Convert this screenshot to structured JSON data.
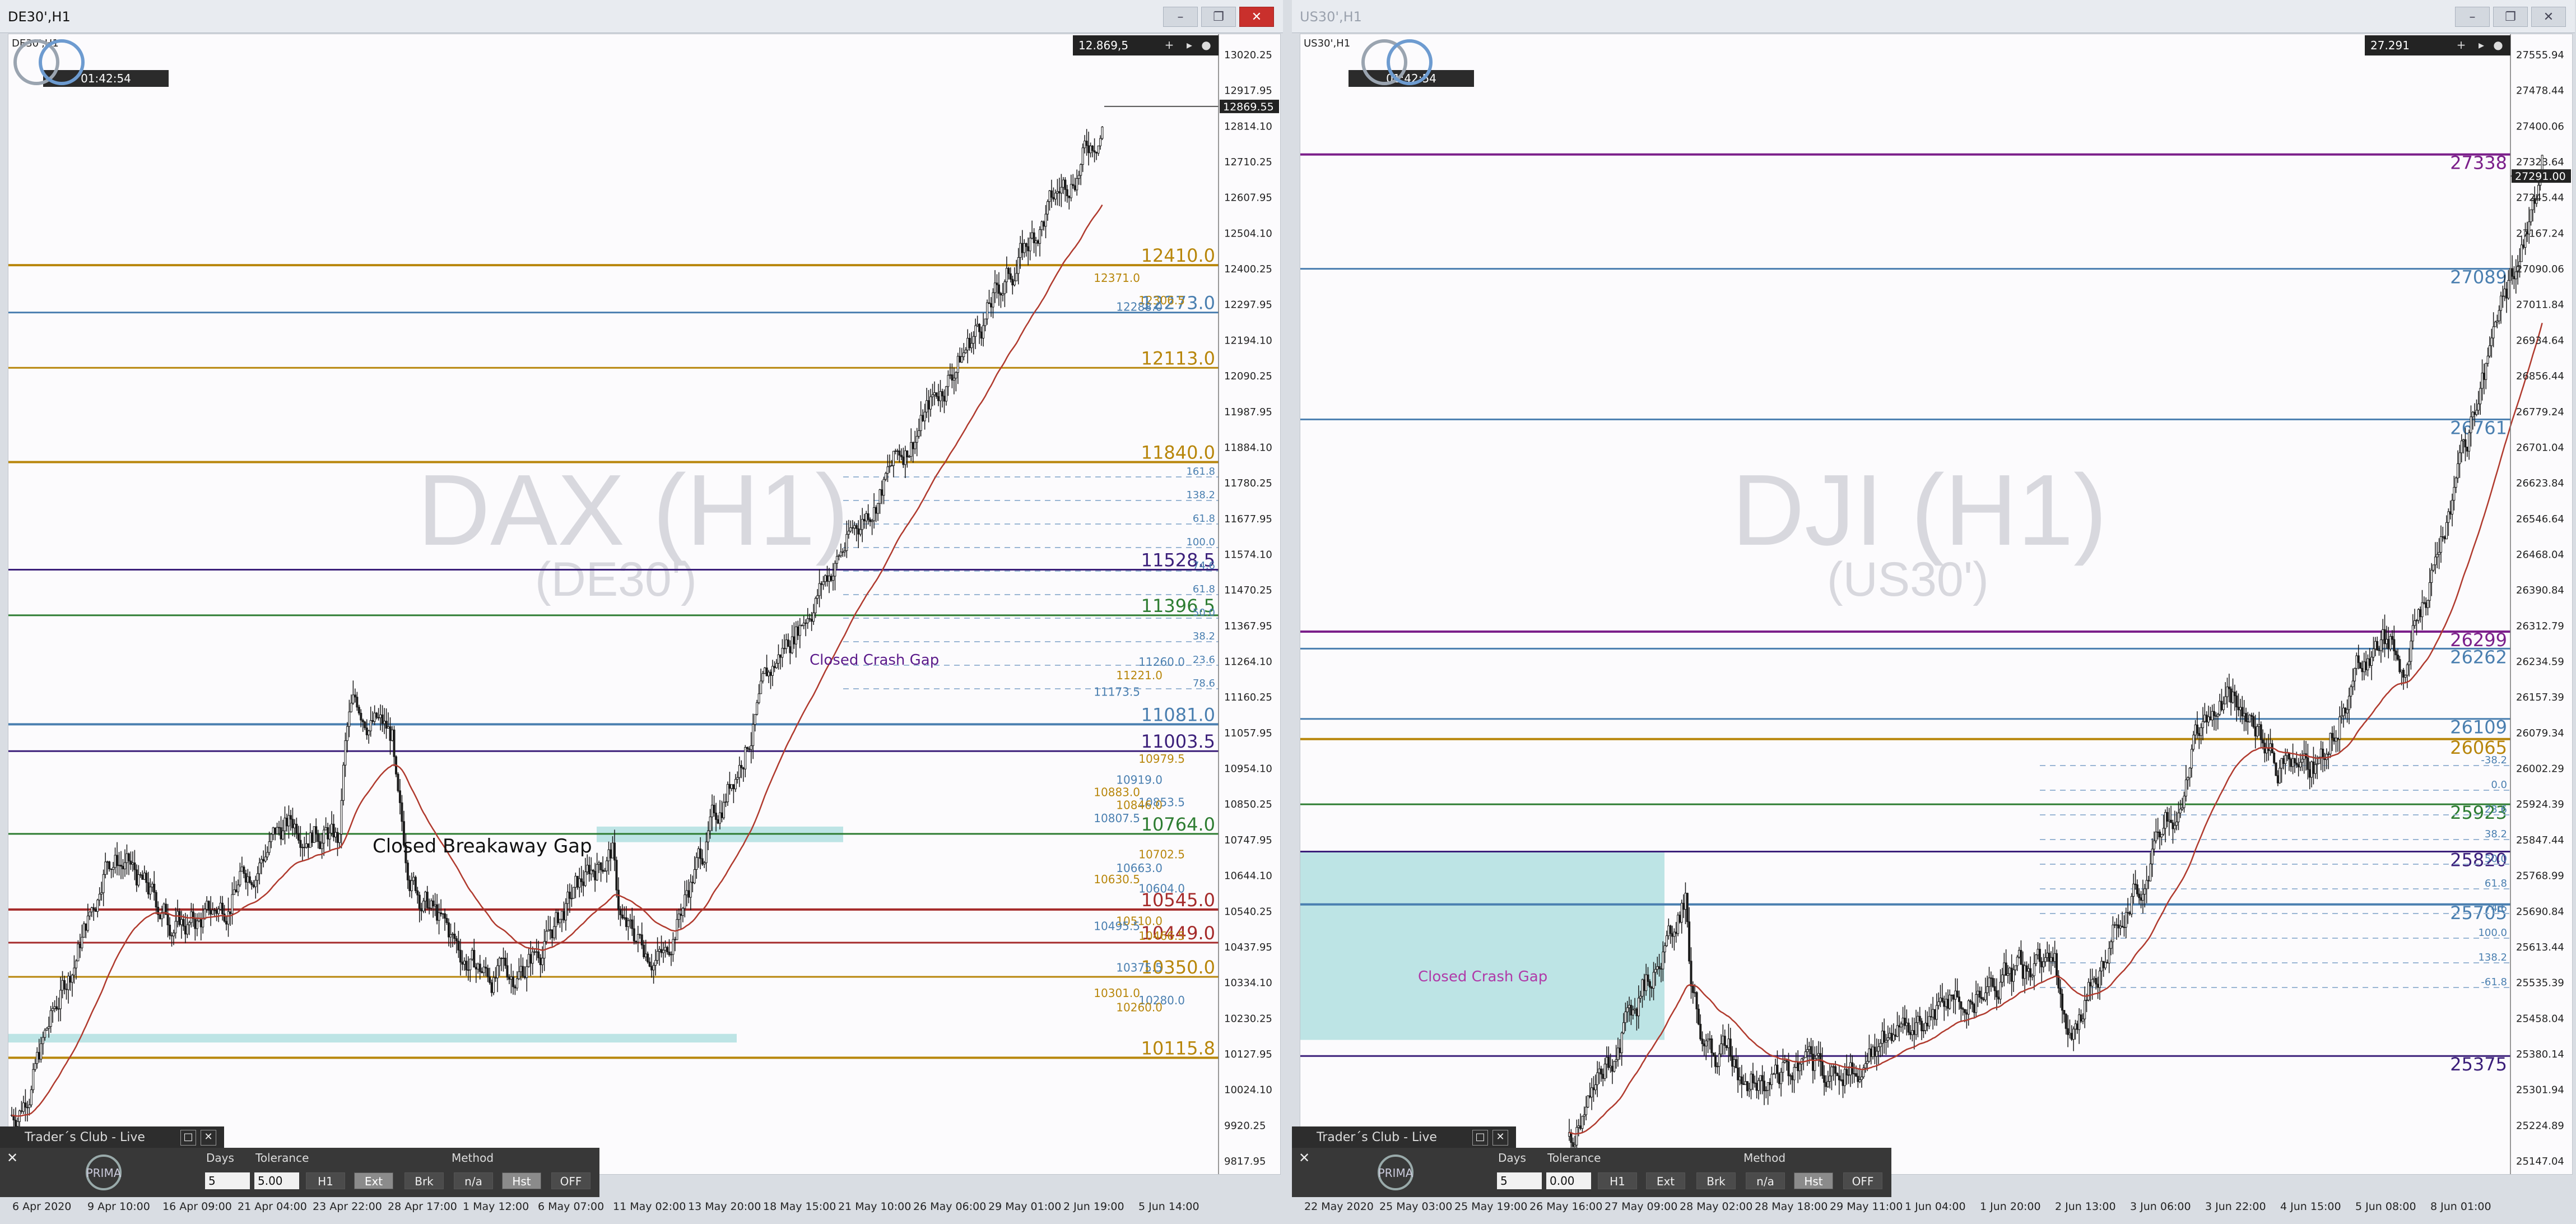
{
  "left_window": {
    "title": "DE30',H1",
    "chart_symbol": "DE30',H1",
    "price_info": "12.869,5",
    "timer": "01:42:54",
    "watermark": "DAX (H1)",
    "watermark_sub": "(DE30')",
    "current_price": "12869.55",
    "price_axis": [
      "13020.25",
      "12917.95",
      "12814.10",
      "12710.25",
      "12607.95",
      "12504.10",
      "12400.25",
      "12297.95",
      "12194.10",
      "12090.25",
      "11987.95",
      "11884.10",
      "11780.25",
      "11677.95",
      "11574.10",
      "11470.25",
      "11367.95",
      "11264.10",
      "11160.25",
      "11057.95",
      "10954.10",
      "10850.25",
      "10747.95",
      "10644.10",
      "10540.25",
      "10437.95",
      "10334.10",
      "10230.25",
      "10127.95",
      "10024.10",
      "9920.25",
      "9817.95"
    ],
    "time_axis": [
      "6 Apr 2020",
      "9 Apr 10:00",
      "16 Apr 09:00",
      "21 Apr 04:00",
      "23 Apr 22:00",
      "28 Apr 17:00",
      "1 May 12:00",
      "6 May 07:00",
      "11 May 02:00",
      "13 May 20:00",
      "18 May 15:00",
      "21 May 10:00",
      "26 May 06:00",
      "29 May 01:00",
      "2 Jun 19:00",
      "5 Jun 14:00"
    ],
    "levels": [
      {
        "price": "12410.0",
        "color": "#b8860b"
      },
      {
        "price": "12273.0",
        "color": "#4a7fb0"
      },
      {
        "price": "12113.0",
        "color": "#b8860b"
      },
      {
        "price": "11840.0",
        "color": "#b8860b"
      },
      {
        "price": "11528.5",
        "color": "#3b1f7a"
      },
      {
        "price": "11396.5",
        "color": "#2e7d32"
      },
      {
        "price": "11081.0",
        "color": "#4a7fb0"
      },
      {
        "price": "11003.5",
        "color": "#3b1f7a"
      },
      {
        "price": "10764.0",
        "color": "#2e7d32"
      },
      {
        "price": "10545.0",
        "color": "#a52a2a"
      },
      {
        "price": "10449.0",
        "color": "#a52a2a"
      },
      {
        "price": "10350.0",
        "color": "#b8860b"
      },
      {
        "price": "10115.8",
        "color": "#b8860b"
      }
    ],
    "small_labels": [
      "12306.5",
      "12288.0",
      "12371.0",
      "11260.0",
      "11221.0",
      "11173.5",
      "10979.5",
      "10919.0",
      "10883.0",
      "10853.5",
      "10846.0",
      "10807.5",
      "10702.5",
      "10663.0",
      "10630.5",
      "10604.0",
      "10510.0",
      "10495.5",
      "10466.5",
      "10375.5",
      "10301.0",
      "10280.0",
      "10260.0"
    ],
    "fib_labels": [
      "161.8",
      "138.2",
      "61.8",
      "100.0",
      "74.6",
      "61.8",
      "50.0",
      "38.2",
      "23.6",
      "78.6"
    ],
    "annotations": {
      "closed_crash_gap": "Closed Crash Gap",
      "closed_breakaway_gap": "Closed Breakaway Gap"
    }
  },
  "right_window": {
    "title": "US30',H1",
    "chart_symbol": "US30',H1",
    "price_info": "27.291",
    "timer": "01:42:54",
    "watermark": "DJI (H1)",
    "watermark_sub": "(US30')",
    "current_price": "27291.00",
    "price_axis": [
      "27555.94",
      "27478.44",
      "27400.06",
      "27323.64",
      "27245.44",
      "27167.24",
      "27090.06",
      "27011.84",
      "26934.64",
      "26856.44",
      "26779.24",
      "26701.04",
      "26623.84",
      "26546.64",
      "26468.04",
      "26390.84",
      "26312.79",
      "26234.59",
      "26157.39",
      "26079.34",
      "26002.29",
      "25924.39",
      "25847.44",
      "25768.99",
      "25690.84",
      "25613.44",
      "25535.39",
      "25458.04",
      "25380.14",
      "25301.94",
      "25224.89",
      "25147.04"
    ],
    "time_axis": [
      "22 May 2020",
      "25 May 03:00",
      "25 May 19:00",
      "26 May 16:00",
      "27 May 09:00",
      "28 May 02:00",
      "28 May 18:00",
      "29 May 11:00",
      "1 Jun 04:00",
      "1 Jun 20:00",
      "2 Jun 13:00",
      "3 Jun 06:00",
      "3 Jun 22:00",
      "4 Jun 15:00",
      "5 Jun 08:00",
      "8 Jun 01:00"
    ],
    "levels": [
      {
        "price": "27338",
        "color": "#7b1f8a"
      },
      {
        "price": "27089",
        "color": "#4a7fb0"
      },
      {
        "price": "26761",
        "color": "#4a7fb0"
      },
      {
        "price": "26299",
        "color": "#7b1f8a"
      },
      {
        "price": "26262",
        "color": "#4a7fb0"
      },
      {
        "price": "26109",
        "color": "#4a7fb0"
      },
      {
        "price": "26065",
        "color": "#b8860b"
      },
      {
        "price": "25923",
        "color": "#2e7d32"
      },
      {
        "price": "25820",
        "color": "#3b1f7a"
      },
      {
        "price": "25705",
        "color": "#4a7fb0"
      },
      {
        "price": "25375",
        "color": "#3b1f7a"
      }
    ],
    "fib_labels": [
      "-38.2",
      "0.0",
      "23.6",
      "38.2",
      "50.0",
      "61.8",
      "74.6",
      "100.0",
      "138.2",
      "-61.8"
    ],
    "annotations": {
      "closed_crash_gap": "Closed Crash Gap"
    }
  },
  "panel": {
    "tab_label": "Trader´s Club - Live",
    "days_caption": "Days",
    "tolerance_caption": "Tolerance",
    "method_caption": "Method",
    "left_days": "5",
    "left_tolerance": "5.00",
    "right_days": "5",
    "right_tolerance": "0.00",
    "buttons": [
      "H1",
      "Ext",
      "Brk",
      "n/a",
      "Hst",
      "OFF"
    ],
    "logo_text": "PRIMA"
  },
  "colors": {
    "candle": "#1a1a1a",
    "ma": "#b03a2e",
    "gap_fill": "#a8dcdc",
    "background": "#fcfbfd"
  }
}
